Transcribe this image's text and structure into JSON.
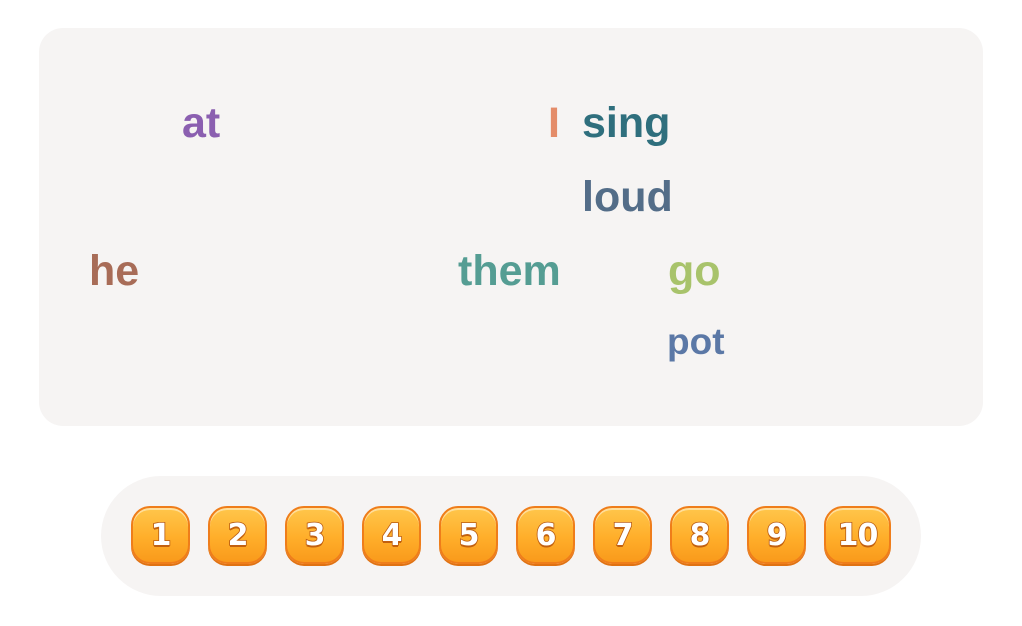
{
  "words": [
    {
      "id": "at",
      "text": "at",
      "color": "#8b5fb0"
    },
    {
      "id": "i",
      "text": "I",
      "color": "#e48c69"
    },
    {
      "id": "sing",
      "text": "sing",
      "color": "#2f6f7d"
    },
    {
      "id": "loud",
      "text": "loud",
      "color": "#536d88"
    },
    {
      "id": "he",
      "text": "he",
      "color": "#a86c57"
    },
    {
      "id": "them",
      "text": "them",
      "color": "#559d93"
    },
    {
      "id": "go",
      "text": "go",
      "color": "#a8c36b"
    },
    {
      "id": "pot",
      "text": "pot",
      "color": "#5b78a6"
    }
  ],
  "levels": [
    "1",
    "2",
    "3",
    "4",
    "5",
    "6",
    "7",
    "8",
    "9",
    "10"
  ],
  "colors": {
    "panel": "#f6f4f3",
    "button_fill": "#ffae2a",
    "button_border": "#ef7d1a"
  }
}
